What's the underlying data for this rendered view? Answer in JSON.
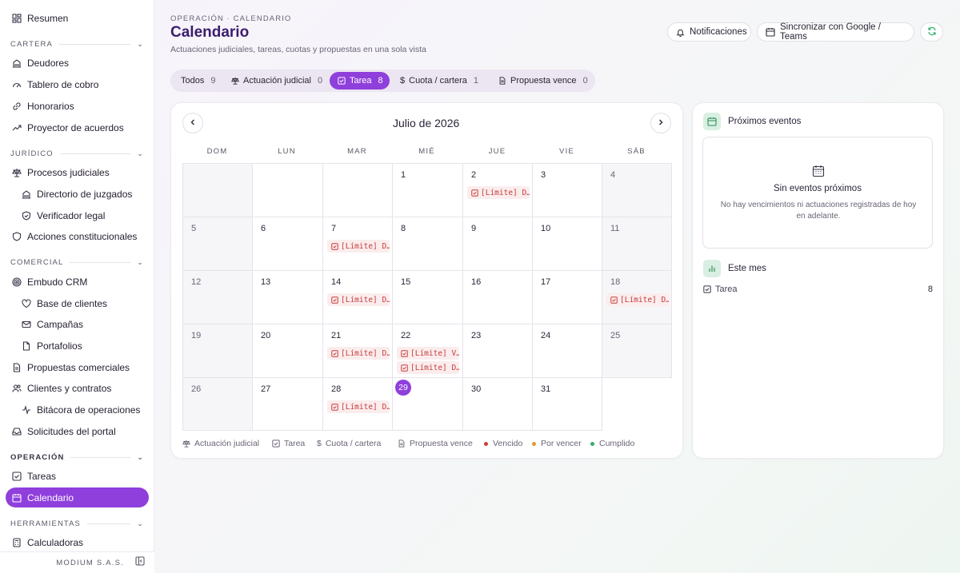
{
  "sidebar": {
    "resumen": "Resumen",
    "sections": {
      "cartera": "CARTERA",
      "juridico": "JURÍDICO",
      "comercial": "COMERCIAL",
      "operacion": "OPERACIÓN",
      "herramientas": "HERRAMIENTAS"
    },
    "items": {
      "deudores": "Deudores",
      "tablero": "Tablero de cobro",
      "honorarios": "Honorarios",
      "proyector": "Proyector de acuerdos",
      "procesos": "Procesos judiciales",
      "directorio": "Directorio de juzgados",
      "verificador": "Verificador legal",
      "acciones": "Acciones constitucionales",
      "embudo": "Embudo CRM",
      "base": "Base de clientes",
      "campanas": "Campañas",
      "portafolios": "Portafolios",
      "propuestas": "Propuestas comerciales",
      "clientes": "Clientes y contratos",
      "bitacora": "Bitácora de operaciones",
      "solicitudes": "Solicitudes del portal",
      "tareas": "Tareas",
      "calendario": "Calendario",
      "calculadoras": "Calculadoras"
    },
    "footer_brand": "MODIUM S.A.S."
  },
  "header": {
    "breadcrumb": "OPERACIÓN · CALENDARIO",
    "title": "Calendario",
    "subtitle": "Actuaciones judiciales, tareas, cuotas y propuestas en una sola vista",
    "notifications": "Notificaciones",
    "sync": "Sincronizar con Google / Teams"
  },
  "filters": {
    "todos": {
      "label": "Todos",
      "count": "9"
    },
    "actuacion": {
      "label": "Actuación judicial",
      "count": "0"
    },
    "tarea": {
      "label": "Tarea",
      "count": "8"
    },
    "cuota": {
      "label": "Cuota / cartera",
      "count": "1"
    },
    "propuesta": {
      "label": "Propuesta vence",
      "count": "0"
    }
  },
  "calendar": {
    "month_label": "Julio de 2026",
    "weekdays": [
      "DOM",
      "LUN",
      "MAR",
      "MIÉ",
      "JUE",
      "VIE",
      "SÁB"
    ],
    "days": {
      "d1": "1",
      "d2": "2",
      "d3": "3",
      "d4": "4",
      "d5": "5",
      "d6": "6",
      "d7": "7",
      "d8": "8",
      "d9": "9",
      "d10": "10",
      "d11": "11",
      "d12": "12",
      "d13": "13",
      "d14": "14",
      "d15": "15",
      "d16": "16",
      "d17": "17",
      "d18": "18",
      "d19": "19",
      "d20": "20",
      "d21": "21",
      "d22": "22",
      "d23": "23",
      "d24": "24",
      "d25": "25",
      "d26": "26",
      "d27": "27",
      "d28": "28",
      "d29": "29",
      "d30": "30",
      "d31": "31"
    },
    "today": "29",
    "events": {
      "e2": "[Límite] D…",
      "e7": "[Límite] D…",
      "e14": "[Límite] D…",
      "e18": "[Límite] D…",
      "e21": "[Límite] D…",
      "e22a": "[Límite] V…",
      "e22b": "[Límite] D…",
      "e28": "[Límite] D…"
    },
    "legend": {
      "actuacion": "Actuación judicial",
      "tarea": "Tarea",
      "cuota": "Cuota / cartera",
      "propuesta": "Propuesta vence",
      "vencido": "Vencido",
      "por_vencer": "Por vencer",
      "cumplido": "Cumplido"
    }
  },
  "upcoming": {
    "title": "Próximos eventos",
    "empty_title": "Sin eventos próximos",
    "empty_text": "No hay vencimientos ni actuaciones registradas de hoy en adelante."
  },
  "this_month": {
    "title": "Este mes",
    "rows": [
      {
        "label": "Tarea",
        "count": "8"
      }
    ]
  },
  "colors": {
    "accent": "#8f3fdc",
    "title": "#3b1e6e",
    "overdue": "#d33a3a",
    "due_soon": "#e09a2b",
    "done": "#2fae6a"
  }
}
